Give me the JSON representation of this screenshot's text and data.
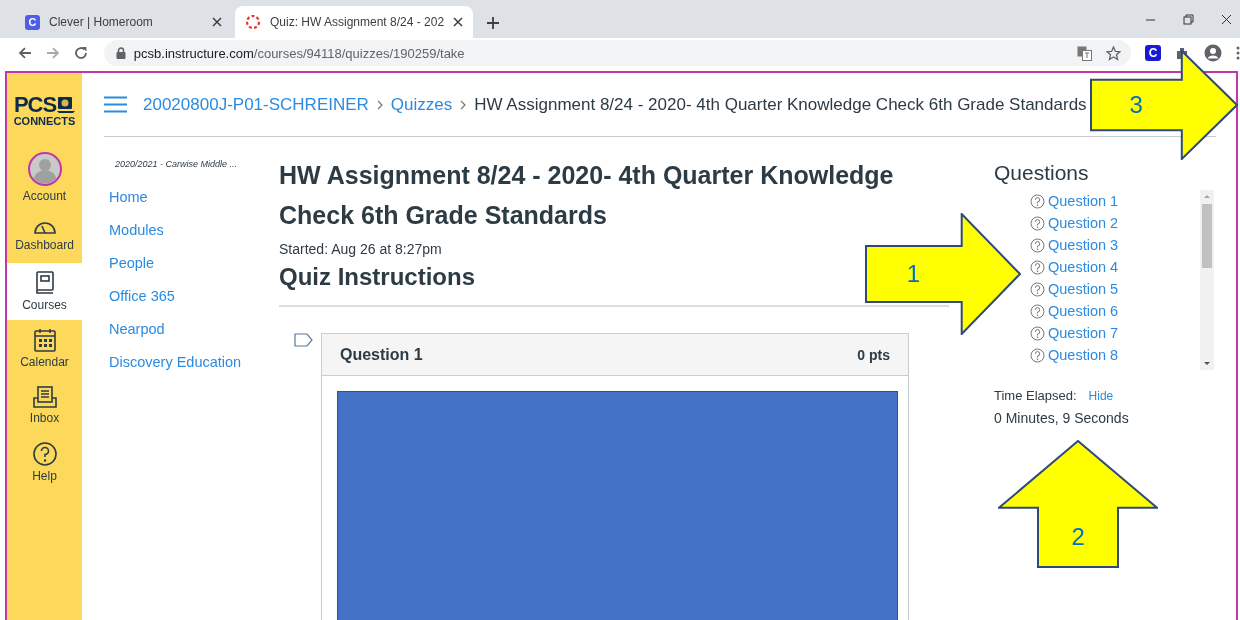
{
  "browser": {
    "tabs": [
      {
        "title": "Clever | Homeroom",
        "selected": false,
        "icon": {
          "kind": "letter",
          "letter": "C"
        }
      },
      {
        "title": "Quiz: HW Assignment 8/24 - 202",
        "selected": true,
        "icon": {
          "kind": "spinner"
        }
      }
    ],
    "url": {
      "host": "pcsb.instructure.com",
      "path": "/courses/94118/quizzes/190259/take"
    },
    "extension": {
      "letter": "C"
    }
  },
  "page": {
    "logo": {
      "line_1": "PCS",
      "line_2": "CONNECTS"
    },
    "global_nav": [
      {
        "label": "Account",
        "kind": "avatar",
        "selected": false
      },
      {
        "label": "Dashboard",
        "kind": "gauge",
        "selected": false
      },
      {
        "label": "Courses",
        "kind": "book",
        "selected": true
      },
      {
        "label": "Calendar",
        "kind": "calendar",
        "selected": false
      },
      {
        "label": "Inbox",
        "kind": "inbox",
        "selected": false
      },
      {
        "label": "Help",
        "kind": "help",
        "selected": false
      }
    ],
    "breadcrumbs": [
      {
        "label": "20020800J-P01-SCHREINER",
        "kind": "link"
      },
      {
        "label": "Quizzes",
        "kind": "link"
      },
      {
        "label": "HW Assignment 8/24 - 2020- 4th Quarter Knowledge Check 6th Grade Standards",
        "kind": "current"
      }
    ],
    "course_nav": {
      "term": "2020/2021 - Carwise Middle ...",
      "items": [
        "Home",
        "Modules",
        "People",
        "Office 365",
        "Nearpod",
        "Discovery Education"
      ]
    },
    "quiz": {
      "title": "HW Assignment 8/24 - 2020- 4th Quarter Knowledge Check 6th Grade Standards",
      "started": "Started: Aug 26 at 8:27pm",
      "instructions_heading": "Quiz Instructions",
      "question": {
        "title": "Question 1",
        "points": "0 pts"
      }
    },
    "sidebar": {
      "heading": "Questions",
      "questions": [
        "Question 1",
        "Question 2",
        "Question 3",
        "Question 4",
        "Question 5",
        "Question 6",
        "Question 7",
        "Question 8"
      ],
      "time_label": "Time Elapsed:",
      "hide_link": "Hide",
      "time": "0 Minutes, 9 Seconds"
    }
  },
  "annotations": [
    {
      "label": "1",
      "kind": "right"
    },
    {
      "label": "2",
      "kind": "up"
    },
    {
      "label": "3",
      "kind": "right"
    }
  ]
}
